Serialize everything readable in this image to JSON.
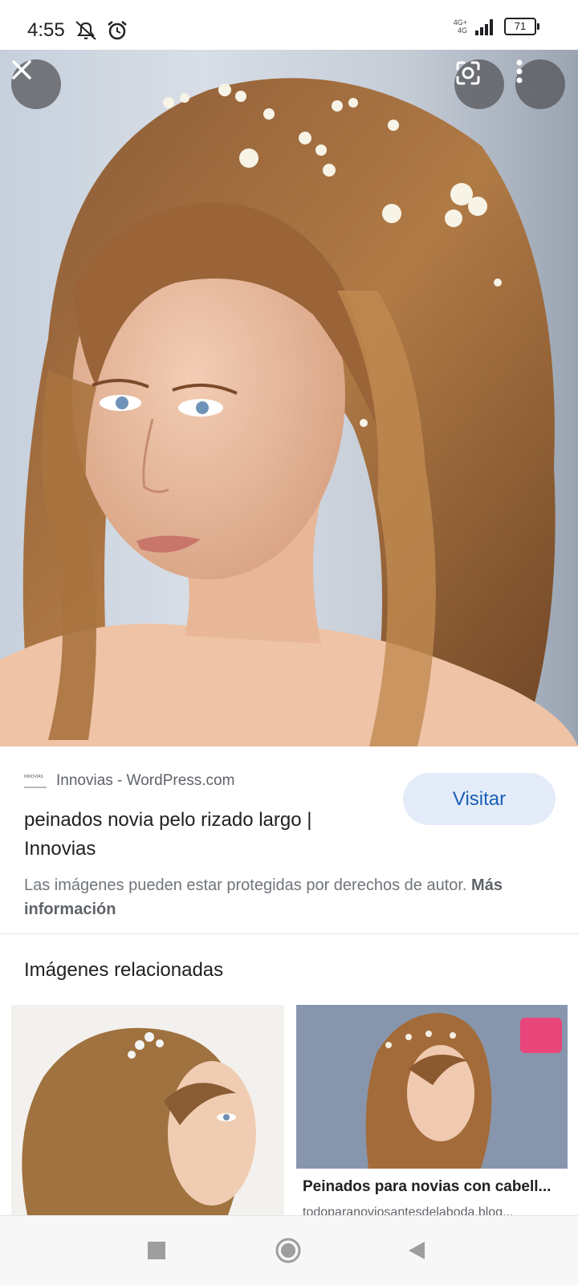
{
  "status_bar": {
    "time": "4:55",
    "network_label_top": "4G+",
    "network_label_bottom": "4G",
    "battery": "71"
  },
  "viewer": {
    "close_icon": "close-icon",
    "lens_icon": "google-lens-icon",
    "menu_icon": "more-vert-icon"
  },
  "result": {
    "favicon_text": "INNOVIAS",
    "source": "Innovias - WordPress.com",
    "visit_label": "Visitar",
    "title": "peinados novia pelo rizado largo | Innovias",
    "copyright_text": "Las imágenes pueden estar protegidas por derechos de autor.",
    "more_info": "Más información"
  },
  "related": {
    "heading": "Imágenes relacionadas",
    "items": [
      {
        "caption": "",
        "site": ""
      },
      {
        "caption": "Peinados para novias con cabell...",
        "site": "todoparanoviosantesdelaboda.blog..."
      }
    ]
  },
  "nav": {
    "recents_icon": "square-recents-icon",
    "home_icon": "circle-home-icon",
    "back_icon": "triangle-back-icon"
  },
  "colors": {
    "accent": "#1a5fb4",
    "visit_bg": "#e3ecf8",
    "badge": "#e8457a"
  }
}
